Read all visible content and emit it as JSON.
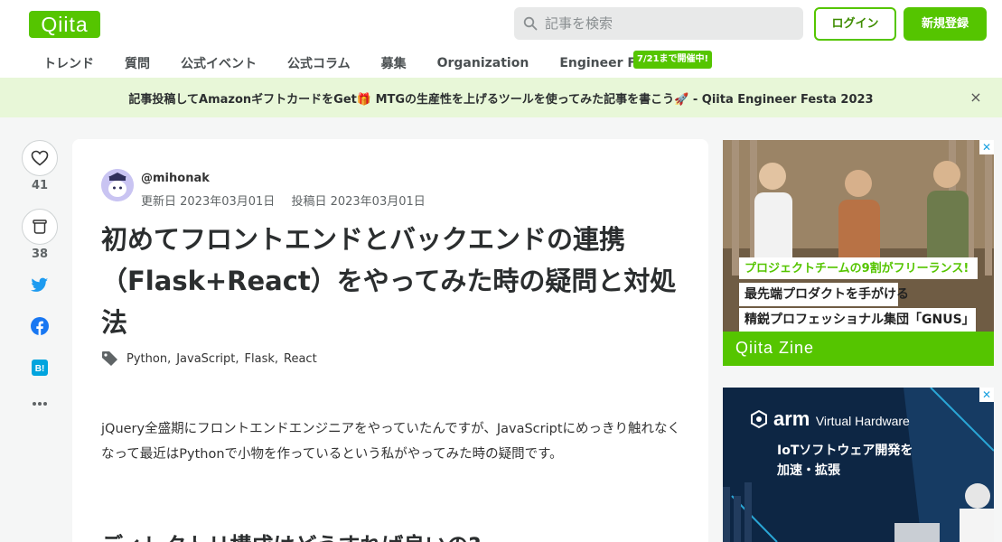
{
  "header": {
    "logo": "Qiita",
    "search_placeholder": "記事を検索",
    "login_label": "ログイン",
    "signup_label": "新規登録"
  },
  "nav": {
    "items": [
      "トレンド",
      "質問",
      "公式イベント",
      "公式コラム",
      "募集",
      "Organization",
      "Engineer Festa"
    ],
    "badge": "7/21まで開催中!"
  },
  "banner": {
    "text": "記事投稿してAmazonギフトカードをGet🎁 MTGの生産性を上げるツールを使ってみた記事を書こう🚀 - Qiita Engineer Festa 2023",
    "close": "×"
  },
  "rail": {
    "likes": "41",
    "stocks": "38"
  },
  "article": {
    "author": "@mihonak",
    "updated": "更新日 2023年03月01日",
    "posted": "投稿日 2023年03月01日",
    "title": "初めてフロントエンドとバックエンドの連携（Flask+React）をやってみた時の疑問と対処法",
    "tags": [
      "Python",
      "JavaScript",
      "Flask",
      "React"
    ],
    "body": "jQuery全盛期にフロントエンドエンジニアをやっていたんですが、JavaScriptにめっきり触れなくなって最近はPythonで小物を作っているという私がやってみた時の疑問です。",
    "heading": "ディレクトリ構成はどうすれば良いの?"
  },
  "ads": {
    "ad1": {
      "line1": "プロジェクトチームの9割がフリーランス!",
      "line2": "最先端プロダクトを手がける",
      "line3": "精鋭プロフェッショナル集団「GNUS」",
      "footer": "Qiita Zine"
    },
    "ad2": {
      "brand": "arm",
      "brand_suffix": "Virtual Hardware",
      "line1": "IoTソフトウェア開発を",
      "line2": "加速・拡張"
    }
  },
  "colors": {
    "brand": "#55c500",
    "banner_bg": "#e8f7d8",
    "page_bg": "#f5f6f6"
  }
}
